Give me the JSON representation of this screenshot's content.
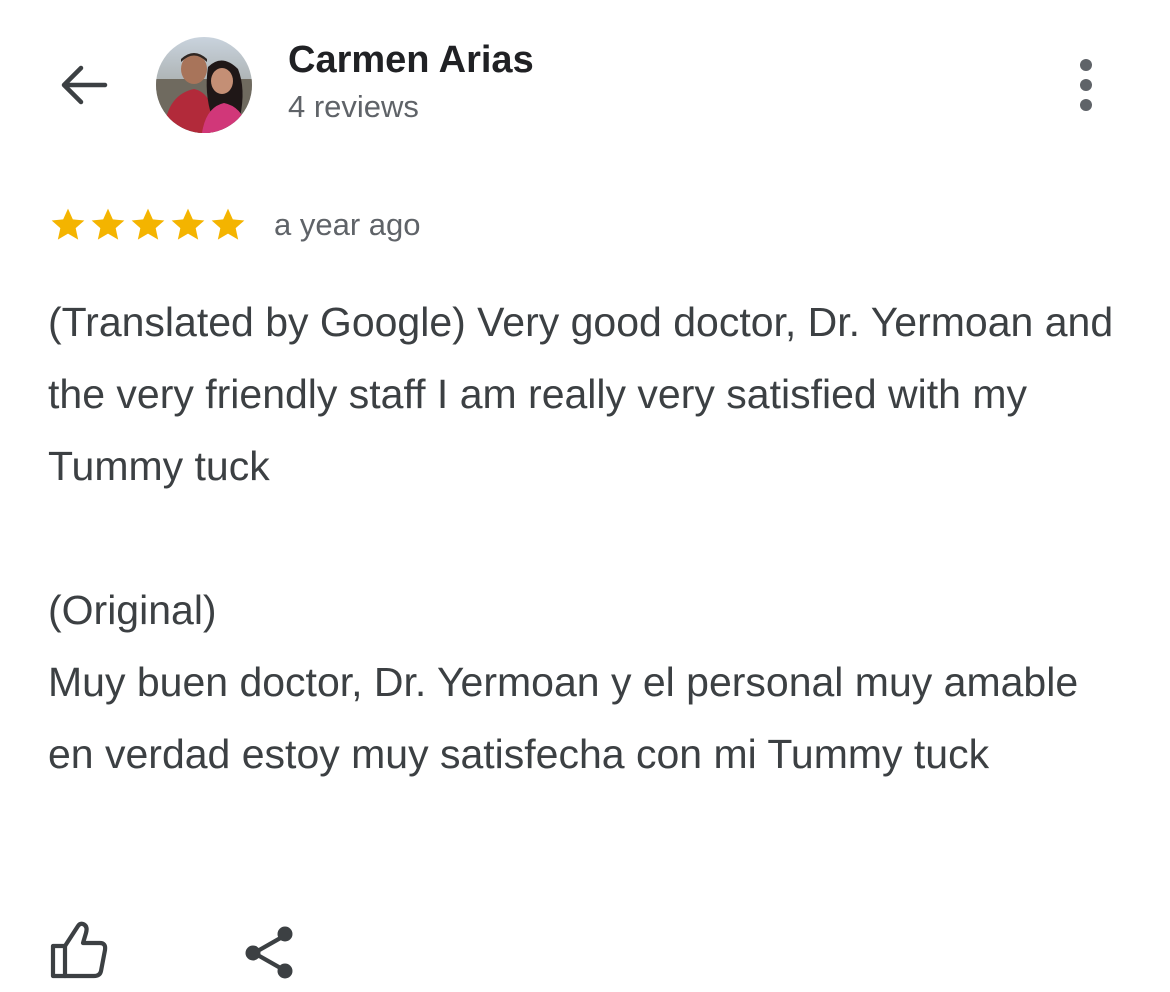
{
  "header": {
    "back_icon": "arrow-left-icon",
    "reviewer_name": "Carmen Arias",
    "review_count": "4 reviews",
    "more_icon": "more-vertical-icon"
  },
  "review": {
    "rating": 5,
    "rating_max": 5,
    "star_color": "#F4B400",
    "date": "a year ago",
    "translated_line": "(Translated by Google) Very good doctor, Dr. Yermoan and the very friendly staff I am really very satisfied with my Tummy tuck",
    "original_label": "(Original)",
    "original_text": "Muy buen doctor, Dr. Yermoan y el personal muy amable en verdad estoy muy satisfecha con mi Tummy tuck"
  },
  "actions": {
    "like_icon": "thumbs-up-icon",
    "share_icon": "share-icon"
  },
  "colors": {
    "primary_text": "#202124",
    "secondary_text": "#5f6368",
    "body_text": "#3c4043",
    "icon": "#5f6368"
  }
}
